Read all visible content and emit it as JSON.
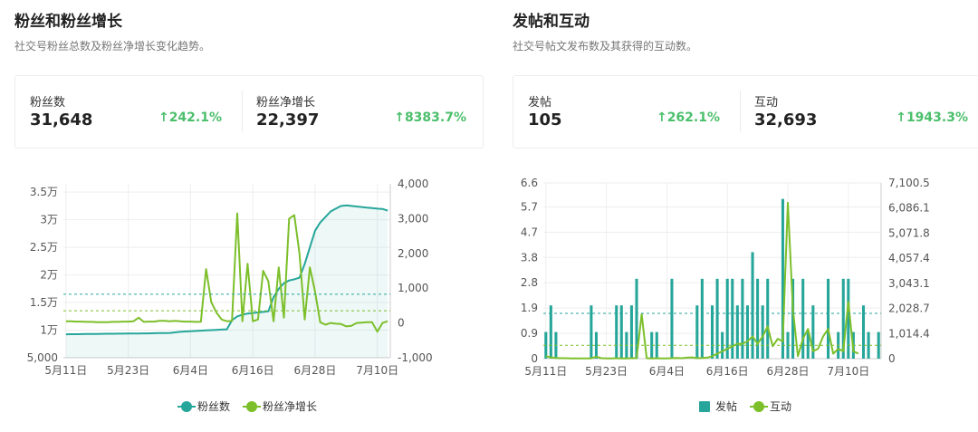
{
  "left": {
    "title": "粉丝和粉丝增长",
    "subtitle": "社交号粉丝总数及粉丝净增长变化趋势。",
    "stats": [
      {
        "label": "粉丝数",
        "value": "31,648",
        "change": "242.1%"
      },
      {
        "label": "粉丝净增长",
        "value": "22,397",
        "change": "8383.7%"
      }
    ],
    "legend": [
      "粉丝数",
      "粉丝净增长"
    ]
  },
  "right": {
    "title": "发帖和互动",
    "subtitle": "社交号帖文发布数及其获得的互动数。",
    "stats": [
      {
        "label": "发帖",
        "value": "105",
        "change": "262.1%"
      },
      {
        "label": "互动",
        "value": "32,693",
        "change": "1943.3%"
      }
    ],
    "legend": [
      "发帖",
      "互动"
    ]
  },
  "colors": {
    "teal": "#26a69a",
    "green": "#7cbf2a",
    "up": "#4bbf6b"
  },
  "chart_data": [
    {
      "type": "line",
      "title": "粉丝和粉丝增长",
      "x_tick_labels": [
        "5月11日",
        "5月23日",
        "6月4日",
        "6月16日",
        "6月28日",
        "7月10日"
      ],
      "x_tick_index": [
        0,
        12,
        24,
        36,
        48,
        60
      ],
      "y_left_tick_labels": [
        "5,000",
        "1万",
        "1.5万",
        "2万",
        "2.5万",
        "3万",
        "3.5万"
      ],
      "y_left_tick_values": [
        5000,
        10000,
        15000,
        20000,
        25000,
        30000,
        35000
      ],
      "y_left_range": [
        5000,
        36500
      ],
      "y_right_tick_labels": [
        "-1,000",
        "0",
        "1,000",
        "2,000",
        "3,000",
        "4,000"
      ],
      "y_right_tick_values": [
        -1000,
        0,
        1000,
        2000,
        3000,
        4000
      ],
      "y_right_range": [
        -1000,
        4000
      ],
      "reference_lines": [
        {
          "axis": "left",
          "value": 16500,
          "color": "#26a69a"
        },
        {
          "axis": "right",
          "value": 350,
          "color": "#7cbf2a"
        }
      ],
      "series": [
        {
          "name": "粉丝数",
          "axis": "left",
          "type": "area",
          "values": [
            9250,
            9260,
            9270,
            9290,
            9300,
            9310,
            9320,
            9330,
            9340,
            9350,
            9360,
            9370,
            9380,
            9390,
            9400,
            9410,
            9420,
            9440,
            9460,
            9480,
            9500,
            9600,
            9700,
            9750,
            9800,
            9850,
            9900,
            9950,
            10000,
            10050,
            10100,
            10150,
            11800,
            12500,
            12800,
            13000,
            13100,
            13200,
            13300,
            13400,
            16000,
            17500,
            18500,
            19000,
            19200,
            19500,
            22000,
            25000,
            28000,
            29500,
            30500,
            31500,
            32000,
            32500,
            32600,
            32500,
            32400,
            32300,
            32200,
            32100,
            32000,
            31950,
            31648
          ]
        },
        {
          "name": "粉丝净增长",
          "axis": "right",
          "type": "line",
          "values": [
            50,
            50,
            40,
            40,
            30,
            30,
            20,
            20,
            20,
            30,
            30,
            40,
            40,
            50,
            150,
            30,
            40,
            40,
            60,
            60,
            50,
            60,
            50,
            40,
            40,
            30,
            30,
            1550,
            600,
            300,
            100,
            50,
            60,
            3150,
            50,
            1700,
            50,
            100,
            1500,
            1200,
            50,
            1600,
            150,
            3000,
            3100,
            2000,
            100,
            1600,
            900,
            20,
            -50,
            0,
            -20,
            -30,
            -100,
            -80,
            0,
            10,
            20,
            20,
            -250,
            0,
            50
          ]
        }
      ]
    },
    {
      "type": "bar",
      "title": "发帖和互动",
      "x_tick_labels": [
        "5月11日",
        "5月23日",
        "6月4日",
        "6月16日",
        "6月28日",
        "7月10日"
      ],
      "x_tick_index": [
        0,
        12,
        24,
        36,
        48,
        60
      ],
      "y_left_tick_labels": [
        "0",
        "0.9",
        "1.9",
        "2.8",
        "3.8",
        "4.7",
        "5.7",
        "6.6"
      ],
      "y_left_tick_values": [
        0,
        0.95,
        1.9,
        2.85,
        3.8,
        4.75,
        5.7,
        6.6
      ],
      "y_left_range": [
        0,
        6.6
      ],
      "y_right_tick_labels": [
        "0",
        "1,014.4",
        "2,028.7",
        "3,043.1",
        "4,057.4",
        "5,071.8",
        "6,086.1",
        "7,100.5"
      ],
      "y_right_tick_values": [
        0,
        1014.4,
        2028.7,
        3043.1,
        4057.4,
        5071.8,
        6086.1,
        7100.5
      ],
      "y_right_range": [
        0,
        7100.5
      ],
      "reference_lines": [
        {
          "axis": "left",
          "value": 1.7,
          "color": "#26a69a"
        },
        {
          "axis": "right",
          "value": 540,
          "color": "#7cbf2a"
        }
      ],
      "series": [
        {
          "name": "发帖",
          "axis": "left",
          "type": "bar",
          "values": [
            1,
            2,
            1,
            0,
            0,
            0,
            0,
            0,
            0,
            2,
            1,
            0,
            0,
            0,
            2,
            2,
            1,
            2,
            3,
            0,
            0,
            1,
            1,
            0,
            0,
            3,
            0,
            0,
            0,
            0,
            2,
            3,
            0,
            2,
            3,
            1,
            3,
            3,
            2,
            3,
            2,
            4,
            3,
            2,
            3,
            0,
            0,
            6,
            1,
            3,
            0,
            3,
            1,
            2,
            0,
            0,
            3,
            0,
            1,
            3,
            3,
            1,
            0,
            2,
            1,
            0,
            1
          ]
        },
        {
          "name": "互动",
          "axis": "right",
          "type": "line",
          "values": [
            100,
            50,
            30,
            20,
            20,
            10,
            10,
            10,
            10,
            10,
            80,
            20,
            10,
            10,
            20,
            10,
            10,
            20,
            20,
            1800,
            20,
            10,
            20,
            10,
            10,
            20,
            30,
            20,
            40,
            50,
            20,
            30,
            40,
            100,
            200,
            300,
            400,
            500,
            600,
            600,
            700,
            900,
            600,
            900,
            1300,
            500,
            800,
            700,
            6300,
            2000,
            100,
            800,
            1200,
            300,
            400,
            900,
            1200,
            200,
            400,
            300,
            2300,
            300,
            200
          ]
        }
      ]
    }
  ]
}
